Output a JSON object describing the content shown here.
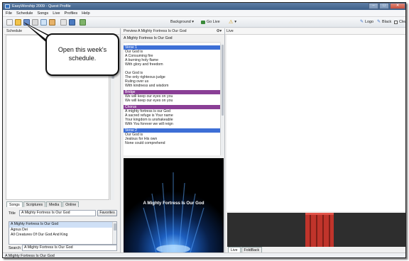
{
  "window": {
    "title": "EasyWorship 2009 - Quest Profile",
    "controls": [
      "–",
      "□",
      "✕"
    ]
  },
  "menu": [
    "File",
    "Schedule",
    "Songs",
    "Live",
    "Profiles",
    "Help"
  ],
  "toolbar": {
    "background_label": "Background ▾",
    "go_live_label": "Go Live",
    "logo_label": "Logo",
    "black_label": "Black",
    "clear_label": "Clea"
  },
  "schedule": {
    "header": "Schedule"
  },
  "preview": {
    "header": "Preview  A Mighty Fortress Is Our God",
    "song_title": "A Mighty Fortress Is Our God",
    "sections": [
      {
        "label": "Verse 1",
        "color": "#3d6fd6",
        "lines": [
          "Our God is",
          "A Consuming fire",
          "A burning holy flame",
          "With glory and freedom",
          "",
          "Our God is",
          "The only righteous judge",
          "Ruling over us",
          "With kindness and wisdom"
        ]
      },
      {
        "label": "Bridge",
        "color": "#8a3f96",
        "lines": [
          "We will keep our eyes on you",
          "We will keep our eyes on you"
        ]
      },
      {
        "label": "Chorus",
        "color": "#8a3f96",
        "lines": [
          "A mighty fortress is our God",
          "A sacred refuge is Your name",
          "Your kingdom  is unshakeable",
          "With You forever we will reign"
        ]
      },
      {
        "label": "Verse 2",
        "color": "#3d6fd6",
        "lines": [
          "Our God is",
          "Jealous for His own",
          "None could comprehend"
        ]
      }
    ],
    "display_caption": "A Mighty Fortress Is Our God"
  },
  "live": {
    "header": "Live",
    "tabs": [
      "Live",
      "FoldBack"
    ]
  },
  "library": {
    "tabs": [
      "Songs",
      "Scriptures",
      "Media",
      "Online"
    ],
    "title_label": "Title",
    "title_value": "A Mighty Fortress Is Our God",
    "favorites_label": "Favorites",
    "songs": [
      "A Mighty Fortress Is Our God",
      "Agnus Dei",
      "All Creatures Of Our God And King"
    ],
    "search_label": "Search",
    "search_value": "A Mighty Fortress Is Our God"
  },
  "status": {
    "text": "A Mighty Fortress Is Our God"
  },
  "callout": {
    "text": "Open this week's schedule."
  },
  "colors": {
    "accent_blue": "#3d6fd6",
    "accent_purple": "#8a3f96",
    "curtain": "#c0342b"
  }
}
